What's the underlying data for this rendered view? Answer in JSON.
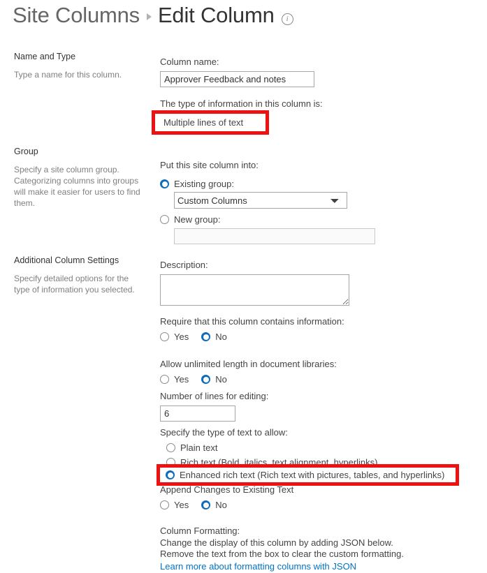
{
  "header": {
    "parent_crumb": "Site Columns",
    "separator_icon": "chevron-right-icon",
    "current_crumb": "Edit Column",
    "info_icon": "info-icon",
    "info_glyph": "i"
  },
  "sections": {
    "name_and_type": {
      "title": "Name and Type",
      "description": "Type a name for this column.",
      "column_name_label": "Column name:",
      "column_name_value": "Approver Feedback and notes",
      "type_label": "The type of information in this column is:",
      "type_value": "Multiple lines of text"
    },
    "group": {
      "title": "Group",
      "description": "Specify a site column group. Categorizing columns into groups will make it easier for users to find them.",
      "put_into_label": "Put this site column into:",
      "existing_group_label": "Existing group:",
      "existing_group_selected": true,
      "existing_group_value": "Custom Columns",
      "existing_group_options": [
        "Custom Columns"
      ],
      "new_group_label": "New group:",
      "new_group_selected": false,
      "new_group_value": ""
    },
    "additional_settings": {
      "title": "Additional Column Settings",
      "description": "Specify detailed options for the type of information you selected.",
      "description_label": "Description:",
      "description_value": "",
      "require_label": "Require that this column contains information:",
      "require_yes": "Yes",
      "require_no": "No",
      "require_value": "No",
      "unlimited_label": "Allow unlimited length in document libraries:",
      "unlimited_yes": "Yes",
      "unlimited_no": "No",
      "unlimited_value": "No",
      "lines_label": "Number of lines for editing:",
      "lines_value": "6",
      "text_type_label": "Specify the type of text to allow:",
      "text_type_plain": "Plain text",
      "text_type_rich": "Rich text (Bold, italics, text alignment, hyperlinks)",
      "text_type_enhanced": "Enhanced rich text (Rich text with pictures, tables, and hyperlinks)",
      "text_type_value": "Enhanced rich text",
      "append_label": "Append Changes to Existing Text",
      "append_yes": "Yes",
      "append_no": "No",
      "append_value": "No"
    },
    "column_formatting": {
      "title": "Column Formatting:",
      "line1": "Change the display of this column by adding JSON below.",
      "line2": "Remove the text from the box to clear the custom formatting.",
      "link": "Learn more about formatting columns with JSON"
    }
  },
  "annotations": {
    "accent_color": "#ee1111",
    "box1_target": "Multiple lines of text",
    "box2_target": "Enhanced rich text (Rich text with pictures, tables, and hyperlinks)"
  }
}
